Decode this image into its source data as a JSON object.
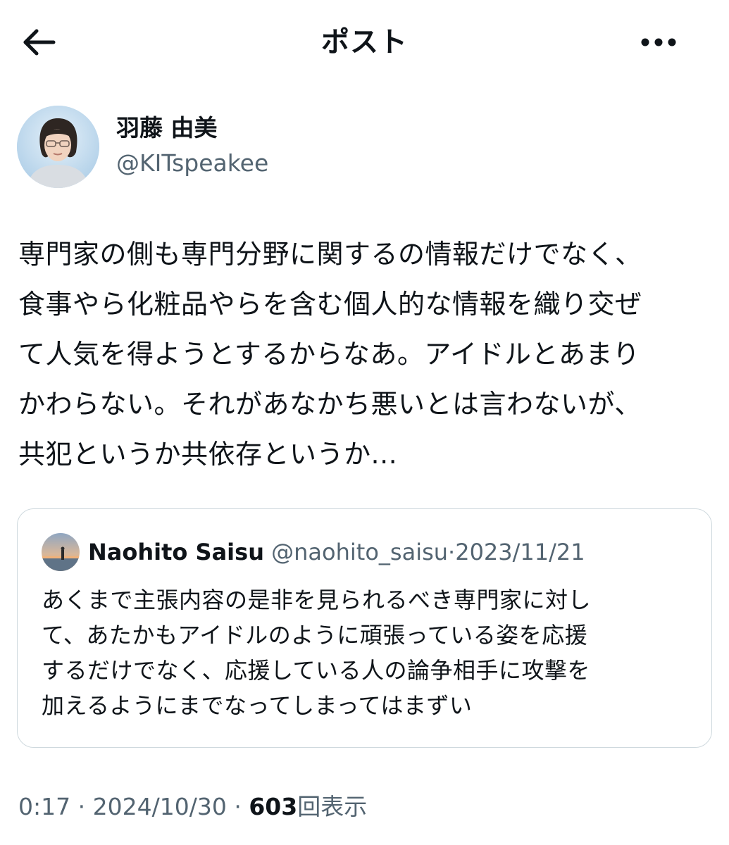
{
  "header": {
    "title": "ポスト"
  },
  "post": {
    "author_name": "羽藤 由美",
    "author_handle": "@KITspeakee",
    "lines": [
      "専門家の側も専門分野に関するの情報だけでなく、",
      "食事やら化粧品やらを含む個人的な情報を織り交ぜ",
      "て人気を得ようとするからなあ。アイドルとあまり",
      "かわらない。それがあなかち悪いとは言わないが、",
      "共犯というか共依存というか..."
    ],
    "time": "0:17",
    "dot1": "·",
    "date": "2024/10/30",
    "dot2": "·",
    "views_count": "603",
    "views_label": "回表示"
  },
  "quote": {
    "author_name": "Naohito Saisu",
    "author_handle": "@naohito_saisu",
    "dot": "·",
    "date": "2023/11/21",
    "lines": [
      "あくまで主張内容の是非を見られるべき専門家に対し",
      "て、あたかもアイドルのように頑張っている姿を応援",
      "するだけでなく、応援している人の論争相手に攻撃を",
      "加えるようにまでなってしまってはまずい"
    ]
  },
  "icons": {
    "back": "arrow-left-icon",
    "more": "more-horizontal-icon"
  },
  "colors": {
    "text": "#0f1419",
    "secondary": "#536471",
    "border": "#cfd9de"
  }
}
